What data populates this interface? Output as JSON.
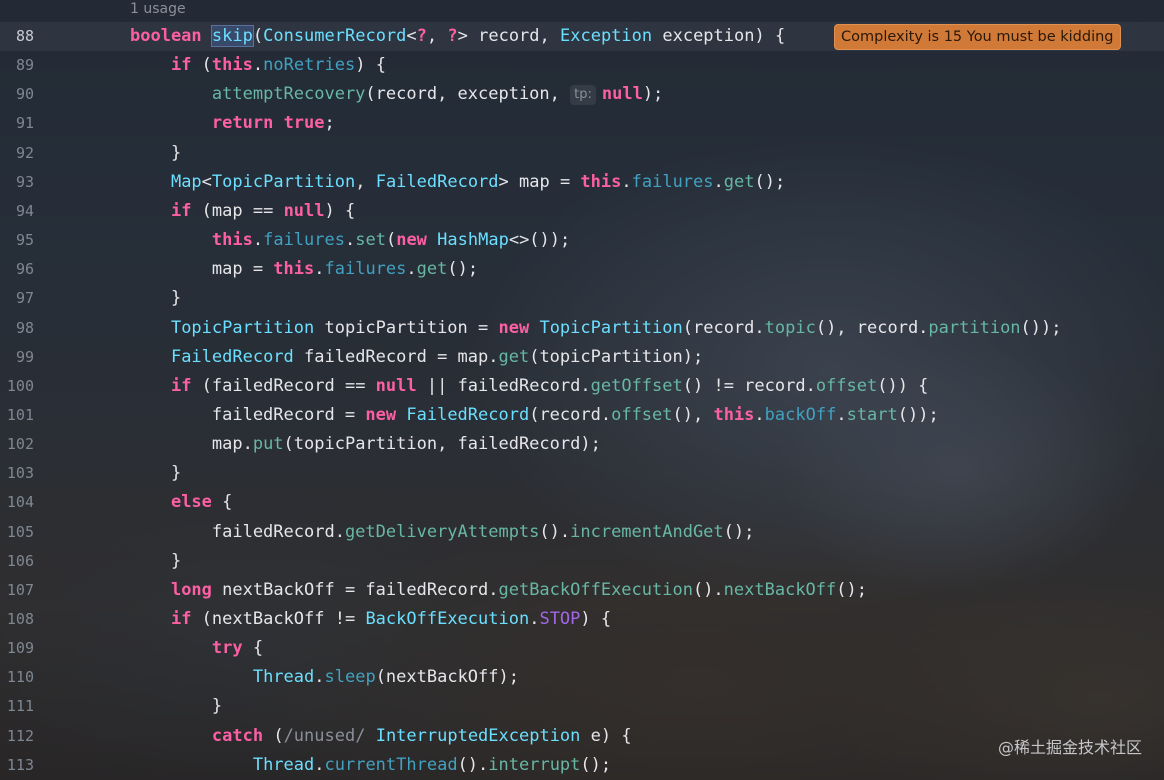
{
  "editor": {
    "usage_hint": "1 usage",
    "complexity_badge": "Complexity is 15 You must be kidding",
    "current_line": "88",
    "watermark": "@稀土掘金技术社区",
    "colors": {
      "keyword": "#fc5fa3",
      "type": "#6bdfff",
      "method": "#67b7a4",
      "field": "#41a1c0",
      "constant": "#a167e6",
      "badge": "#d17a38"
    },
    "lines": [
      {
        "num": "88",
        "tokens": [
          {
            "t": "boolean",
            "c": "kw"
          },
          {
            "t": " ",
            "c": "pl"
          },
          {
            "t": "skip",
            "c": "hl"
          },
          {
            "t": "(",
            "c": "pl"
          },
          {
            "t": "ConsumerRecord",
            "c": "ty"
          },
          {
            "t": "<",
            "c": "pl"
          },
          {
            "t": "?",
            "c": "kw"
          },
          {
            "t": ", ",
            "c": "pl"
          },
          {
            "t": "?",
            "c": "kw"
          },
          {
            "t": "> record, ",
            "c": "pl"
          },
          {
            "t": "Exception",
            "c": "ty"
          },
          {
            "t": " exception) {",
            "c": "pl"
          }
        ]
      },
      {
        "num": "89",
        "tokens": [
          {
            "t": "    ",
            "c": "pl"
          },
          {
            "t": "if",
            "c": "kw"
          },
          {
            "t": " (",
            "c": "pl"
          },
          {
            "t": "this",
            "c": "kw"
          },
          {
            "t": ".",
            "c": "pl"
          },
          {
            "t": "noRetries",
            "c": "fld"
          },
          {
            "t": ") {",
            "c": "pl"
          }
        ]
      },
      {
        "num": "90",
        "tokens": [
          {
            "t": "        ",
            "c": "pl"
          },
          {
            "t": "attemptRecovery",
            "c": "fn"
          },
          {
            "t": "(record, exception, ",
            "c": "pl"
          },
          {
            "t": "tp:",
            "c": "hint"
          },
          {
            "t": "null",
            "c": "kw"
          },
          {
            "t": ");",
            "c": "pl"
          }
        ]
      },
      {
        "num": "91",
        "tokens": [
          {
            "t": "        ",
            "c": "pl"
          },
          {
            "t": "return",
            "c": "kw"
          },
          {
            "t": " ",
            "c": "pl"
          },
          {
            "t": "true",
            "c": "kw"
          },
          {
            "t": ";",
            "c": "pl"
          }
        ]
      },
      {
        "num": "92",
        "tokens": [
          {
            "t": "    }",
            "c": "pl"
          }
        ]
      },
      {
        "num": "93",
        "tokens": [
          {
            "t": "    ",
            "c": "pl"
          },
          {
            "t": "Map",
            "c": "ty"
          },
          {
            "t": "<",
            "c": "pl"
          },
          {
            "t": "TopicPartition",
            "c": "ty"
          },
          {
            "t": ", ",
            "c": "pl"
          },
          {
            "t": "FailedRecord",
            "c": "ty"
          },
          {
            "t": "> map = ",
            "c": "pl"
          },
          {
            "t": "this",
            "c": "kw"
          },
          {
            "t": ".",
            "c": "pl"
          },
          {
            "t": "failures",
            "c": "fld"
          },
          {
            "t": ".",
            "c": "pl"
          },
          {
            "t": "get",
            "c": "fn"
          },
          {
            "t": "();",
            "c": "pl"
          }
        ]
      },
      {
        "num": "94",
        "tokens": [
          {
            "t": "    ",
            "c": "pl"
          },
          {
            "t": "if",
            "c": "kw"
          },
          {
            "t": " (map == ",
            "c": "pl"
          },
          {
            "t": "null",
            "c": "kw"
          },
          {
            "t": ") {",
            "c": "pl"
          }
        ]
      },
      {
        "num": "95",
        "tokens": [
          {
            "t": "        ",
            "c": "pl"
          },
          {
            "t": "this",
            "c": "kw"
          },
          {
            "t": ".",
            "c": "pl"
          },
          {
            "t": "failures",
            "c": "fld"
          },
          {
            "t": ".",
            "c": "pl"
          },
          {
            "t": "set",
            "c": "fn"
          },
          {
            "t": "(",
            "c": "pl"
          },
          {
            "t": "new",
            "c": "kw"
          },
          {
            "t": " ",
            "c": "pl"
          },
          {
            "t": "HashMap",
            "c": "ty"
          },
          {
            "t": "<>());",
            "c": "pl"
          }
        ]
      },
      {
        "num": "96",
        "tokens": [
          {
            "t": "        map = ",
            "c": "pl"
          },
          {
            "t": "this",
            "c": "kw"
          },
          {
            "t": ".",
            "c": "pl"
          },
          {
            "t": "failures",
            "c": "fld"
          },
          {
            "t": ".",
            "c": "pl"
          },
          {
            "t": "get",
            "c": "fn"
          },
          {
            "t": "();",
            "c": "pl"
          }
        ]
      },
      {
        "num": "97",
        "tokens": [
          {
            "t": "    }",
            "c": "pl"
          }
        ]
      },
      {
        "num": "98",
        "tokens": [
          {
            "t": "    ",
            "c": "pl"
          },
          {
            "t": "TopicPartition",
            "c": "ty"
          },
          {
            "t": " topicPartition = ",
            "c": "pl"
          },
          {
            "t": "new",
            "c": "kw"
          },
          {
            "t": " ",
            "c": "pl"
          },
          {
            "t": "TopicPartition",
            "c": "ty"
          },
          {
            "t": "(record.",
            "c": "pl"
          },
          {
            "t": "topic",
            "c": "fn"
          },
          {
            "t": "(), record.",
            "c": "pl"
          },
          {
            "t": "partition",
            "c": "fn"
          },
          {
            "t": "());",
            "c": "pl"
          }
        ]
      },
      {
        "num": "99",
        "tokens": [
          {
            "t": "    ",
            "c": "pl"
          },
          {
            "t": "FailedRecord",
            "c": "ty"
          },
          {
            "t": " failedRecord = map.",
            "c": "pl"
          },
          {
            "t": "get",
            "c": "fn"
          },
          {
            "t": "(topicPartition);",
            "c": "pl"
          }
        ]
      },
      {
        "num": "100",
        "tokens": [
          {
            "t": "    ",
            "c": "pl"
          },
          {
            "t": "if",
            "c": "kw"
          },
          {
            "t": " (failedRecord == ",
            "c": "pl"
          },
          {
            "t": "null",
            "c": "kw"
          },
          {
            "t": " || failedRecord.",
            "c": "pl"
          },
          {
            "t": "getOffset",
            "c": "fn"
          },
          {
            "t": "() != record.",
            "c": "pl"
          },
          {
            "t": "offset",
            "c": "fn"
          },
          {
            "t": "()) {",
            "c": "pl"
          }
        ]
      },
      {
        "num": "101",
        "tokens": [
          {
            "t": "        failedRecord = ",
            "c": "pl"
          },
          {
            "t": "new",
            "c": "kw"
          },
          {
            "t": " ",
            "c": "pl"
          },
          {
            "t": "FailedRecord",
            "c": "ty"
          },
          {
            "t": "(record.",
            "c": "pl"
          },
          {
            "t": "offset",
            "c": "fn"
          },
          {
            "t": "(), ",
            "c": "pl"
          },
          {
            "t": "this",
            "c": "kw"
          },
          {
            "t": ".",
            "c": "pl"
          },
          {
            "t": "backOff",
            "c": "fld"
          },
          {
            "t": ".",
            "c": "pl"
          },
          {
            "t": "start",
            "c": "fn"
          },
          {
            "t": "());",
            "c": "pl"
          }
        ]
      },
      {
        "num": "102",
        "tokens": [
          {
            "t": "        map.",
            "c": "pl"
          },
          {
            "t": "put",
            "c": "fn"
          },
          {
            "t": "(topicPartition, failedRecord);",
            "c": "pl"
          }
        ]
      },
      {
        "num": "103",
        "tokens": [
          {
            "t": "    }",
            "c": "pl"
          }
        ]
      },
      {
        "num": "104",
        "tokens": [
          {
            "t": "    ",
            "c": "pl"
          },
          {
            "t": "else",
            "c": "kw"
          },
          {
            "t": " {",
            "c": "pl"
          }
        ]
      },
      {
        "num": "105",
        "tokens": [
          {
            "t": "        failedRecord.",
            "c": "pl"
          },
          {
            "t": "getDeliveryAttempts",
            "c": "fn"
          },
          {
            "t": "().",
            "c": "pl"
          },
          {
            "t": "incrementAndGet",
            "c": "fn"
          },
          {
            "t": "();",
            "c": "pl"
          }
        ]
      },
      {
        "num": "106",
        "tokens": [
          {
            "t": "    }",
            "c": "pl"
          }
        ]
      },
      {
        "num": "107",
        "tokens": [
          {
            "t": "    ",
            "c": "pl"
          },
          {
            "t": "long",
            "c": "kw"
          },
          {
            "t": " nextBackOff = failedRecord.",
            "c": "pl"
          },
          {
            "t": "getBackOffExecution",
            "c": "fn"
          },
          {
            "t": "().",
            "c": "pl"
          },
          {
            "t": "nextBackOff",
            "c": "fn"
          },
          {
            "t": "();",
            "c": "pl"
          }
        ]
      },
      {
        "num": "108",
        "tokens": [
          {
            "t": "    ",
            "c": "pl"
          },
          {
            "t": "if",
            "c": "kw"
          },
          {
            "t": " (nextBackOff != ",
            "c": "pl"
          },
          {
            "t": "BackOffExecution",
            "c": "ty"
          },
          {
            "t": ".",
            "c": "pl"
          },
          {
            "t": "STOP",
            "c": "cst"
          },
          {
            "t": ") {",
            "c": "pl"
          }
        ]
      },
      {
        "num": "109",
        "tokens": [
          {
            "t": "        ",
            "c": "pl"
          },
          {
            "t": "try",
            "c": "kw"
          },
          {
            "t": " {",
            "c": "pl"
          }
        ]
      },
      {
        "num": "110",
        "tokens": [
          {
            "t": "            ",
            "c": "pl"
          },
          {
            "t": "Thread",
            "c": "ty"
          },
          {
            "t": ".",
            "c": "pl"
          },
          {
            "t": "sleep",
            "c": "fld"
          },
          {
            "t": "(nextBackOff);",
            "c": "pl"
          }
        ]
      },
      {
        "num": "111",
        "tokens": [
          {
            "t": "        }",
            "c": "pl"
          }
        ]
      },
      {
        "num": "112",
        "tokens": [
          {
            "t": "        ",
            "c": "pl"
          },
          {
            "t": "catch",
            "c": "kw"
          },
          {
            "t": " (",
            "c": "pl"
          },
          {
            "t": "/unused/",
            "c": "cmt"
          },
          {
            "t": " ",
            "c": "pl"
          },
          {
            "t": "InterruptedException",
            "c": "ty"
          },
          {
            "t": " e) {",
            "c": "pl"
          }
        ]
      },
      {
        "num": "113",
        "tokens": [
          {
            "t": "            ",
            "c": "pl"
          },
          {
            "t": "Thread",
            "c": "ty"
          },
          {
            "t": ".",
            "c": "pl"
          },
          {
            "t": "currentThread",
            "c": "fld"
          },
          {
            "t": "().",
            "c": "pl"
          },
          {
            "t": "interrupt",
            "c": "fn"
          },
          {
            "t": "();",
            "c": "pl"
          }
        ]
      }
    ]
  }
}
